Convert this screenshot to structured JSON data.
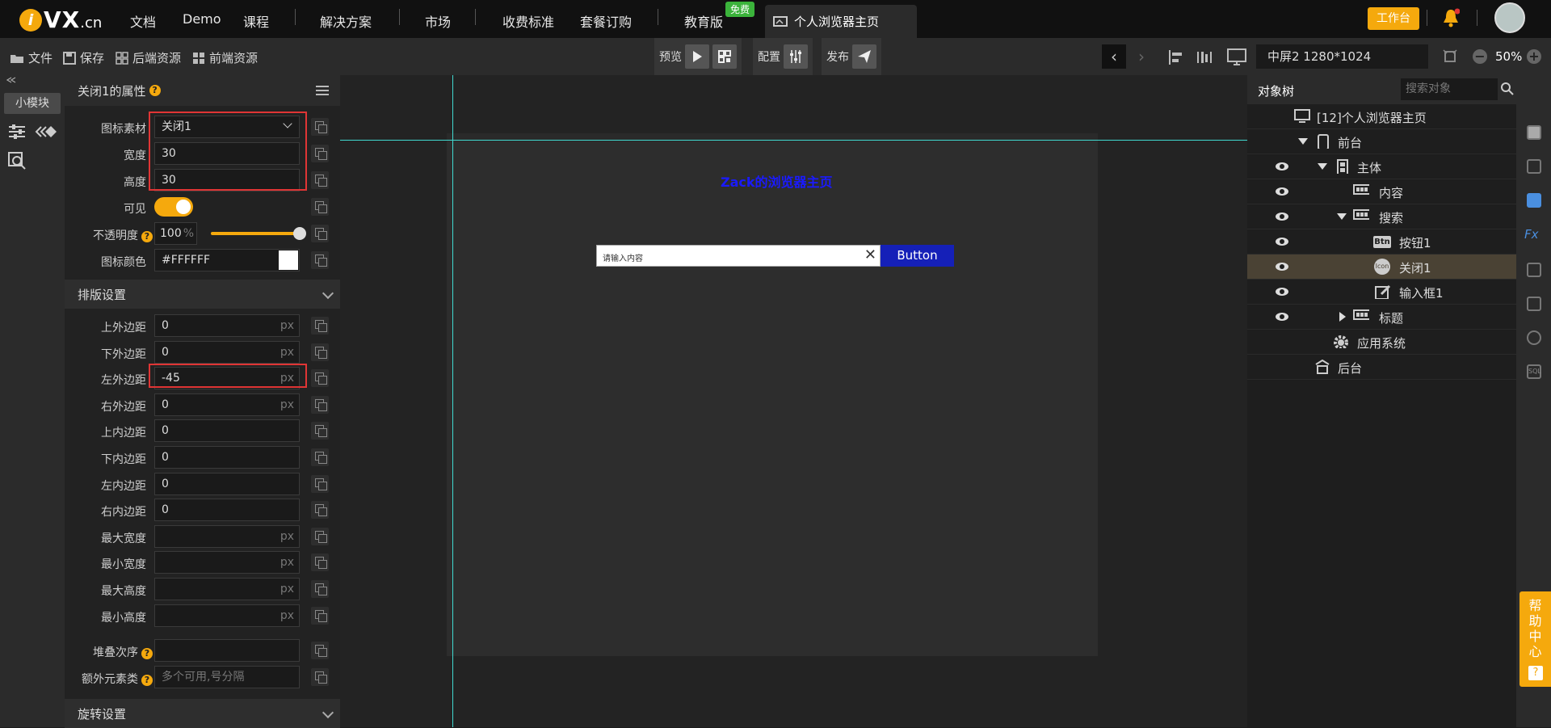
{
  "topbar": {
    "logo_main": "VX",
    "logo_suffix": ".cn",
    "nav": [
      "文档",
      "Demo",
      "课程",
      "解决方案",
      "市场",
      "收费标准",
      "套餐订购",
      "教育版"
    ],
    "free_badge": "免费",
    "active_tab": "个人浏览器主页",
    "workbench": "工作台"
  },
  "toolbar": {
    "file": "文件",
    "save": "保存",
    "backend_res": "后端资源",
    "frontend_res": "前端资源",
    "preview": "预览",
    "config": "配置",
    "publish": "发布",
    "resolution": "中屏2 1280*1024",
    "zoom": "50%"
  },
  "left_strip": {
    "module_btn": "小模块"
  },
  "props": {
    "title": "关闭1的属性",
    "qmark": "?",
    "icon_material_label": "图标素材",
    "icon_material_value": "关闭1",
    "width_label": "宽度",
    "width_value": "30",
    "height_label": "高度",
    "height_value": "30",
    "visible_label": "可见",
    "opacity_label": "不透明度",
    "opacity_value": "100",
    "opacity_unit": "%",
    "opacity_level": 1.0,
    "icon_color_label": "图标颜色",
    "icon_color_value": "#FFFFFF",
    "layout_section": "排版设置",
    "layout": [
      {
        "label": "上外边距",
        "value": "0",
        "unit": "px"
      },
      {
        "label": "下外边距",
        "value": "0",
        "unit": "px"
      },
      {
        "label": "左外边距",
        "value": "-45",
        "unit": "px"
      },
      {
        "label": "右外边距",
        "value": "0",
        "unit": "px"
      },
      {
        "label": "上内边距",
        "value": "0",
        "unit": ""
      },
      {
        "label": "下内边距",
        "value": "0",
        "unit": ""
      },
      {
        "label": "左内边距",
        "value": "0",
        "unit": ""
      },
      {
        "label": "右内边距",
        "value": "0",
        "unit": ""
      },
      {
        "label": "最大宽度",
        "value": "",
        "unit": "px"
      },
      {
        "label": "最小宽度",
        "value": "",
        "unit": "px"
      },
      {
        "label": "最大高度",
        "value": "",
        "unit": "px"
      },
      {
        "label": "最小高度",
        "value": "",
        "unit": "px"
      }
    ],
    "zindex_label": "堆叠次序",
    "extra_class_label": "额外元素类",
    "extra_class_placeholder": "多个可用,号分隔",
    "rotate_section": "旋转设置"
  },
  "canvas": {
    "page_heading": "Zack的浏览器主页",
    "search_placeholder": "请输入内容",
    "search_close": "✕",
    "search_button": "Button"
  },
  "object_tree": {
    "tab": "对象树",
    "search_placeholder": "搜索对象",
    "root": "[12]个人浏览器主页",
    "nodes": [
      "前台",
      "主体",
      "内容",
      "搜索",
      "按钮1",
      "关闭1",
      "输入框1",
      "标题",
      "应用系统",
      "后台"
    ]
  },
  "help": {
    "text": "帮助中心",
    "qmark": "?"
  },
  "colors": {
    "accent": "#f5a90d",
    "guide": "#41d9d0",
    "highlight": "#e03535",
    "button": "#1520b8"
  }
}
